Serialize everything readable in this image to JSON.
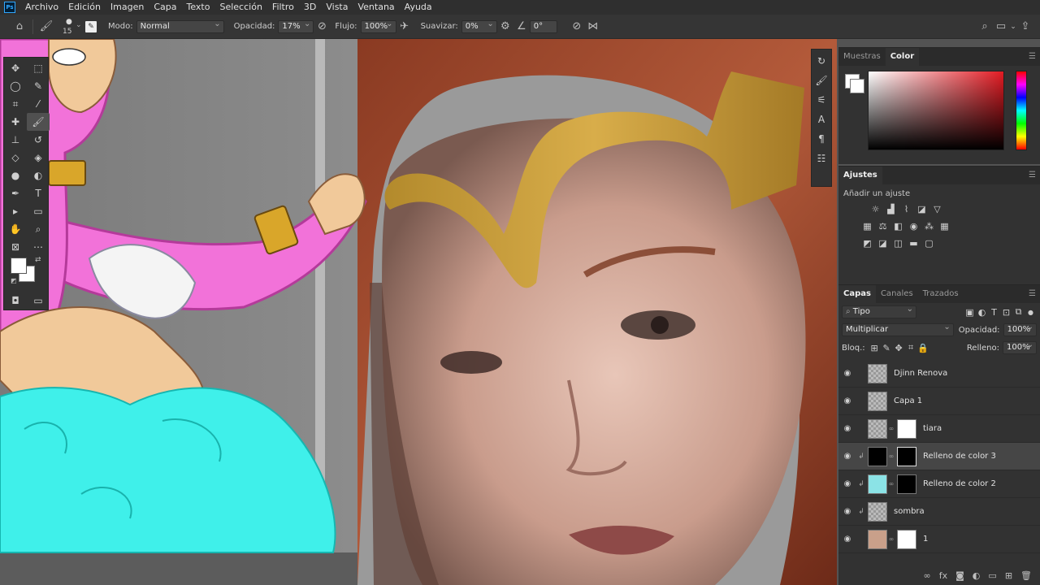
{
  "app": {
    "logo": "Ps"
  },
  "menu": [
    "Archivo",
    "Edición",
    "Imagen",
    "Capa",
    "Texto",
    "Selección",
    "Filtro",
    "3D",
    "Vista",
    "Ventana",
    "Ayuda"
  ],
  "options": {
    "brush_size": "15",
    "mode_label": "Modo:",
    "mode_value": "Normal",
    "opacity_label": "Opacidad:",
    "opacity_value": "17%",
    "flow_label": "Flujo:",
    "flow_value": "100%",
    "smooth_label": "Suavizar:",
    "smooth_value": "0%",
    "angle_value": "0°"
  },
  "color_panel": {
    "tabs": [
      "Muestras",
      "Color"
    ],
    "active_tab": "Color",
    "hue_color": "#e31b23",
    "foreground": "#ffffff",
    "background": "#ffffff"
  },
  "adjustments": {
    "title": "Ajustes",
    "add_label": "Añadir un ajuste"
  },
  "layers_panel": {
    "tabs": [
      "Capas",
      "Canales",
      "Trazados"
    ],
    "filter_value": "Tipo",
    "blend_mode": "Multiplicar",
    "opacity_label": "Opacidad:",
    "opacity_value": "100%",
    "lock_label": "Bloq.:",
    "fill_label": "Relleno:",
    "fill_value": "100%",
    "layers": [
      {
        "name": "Djinn Renova",
        "selected": false
      },
      {
        "name": "Capa 1",
        "selected": false
      },
      {
        "name": "tiara",
        "selected": false
      },
      {
        "name": "Relleno de color 3",
        "selected": true
      },
      {
        "name": "Relleno de color 2",
        "selected": false
      },
      {
        "name": "sombra",
        "selected": false
      },
      {
        "name": "1",
        "selected": false
      }
    ]
  }
}
